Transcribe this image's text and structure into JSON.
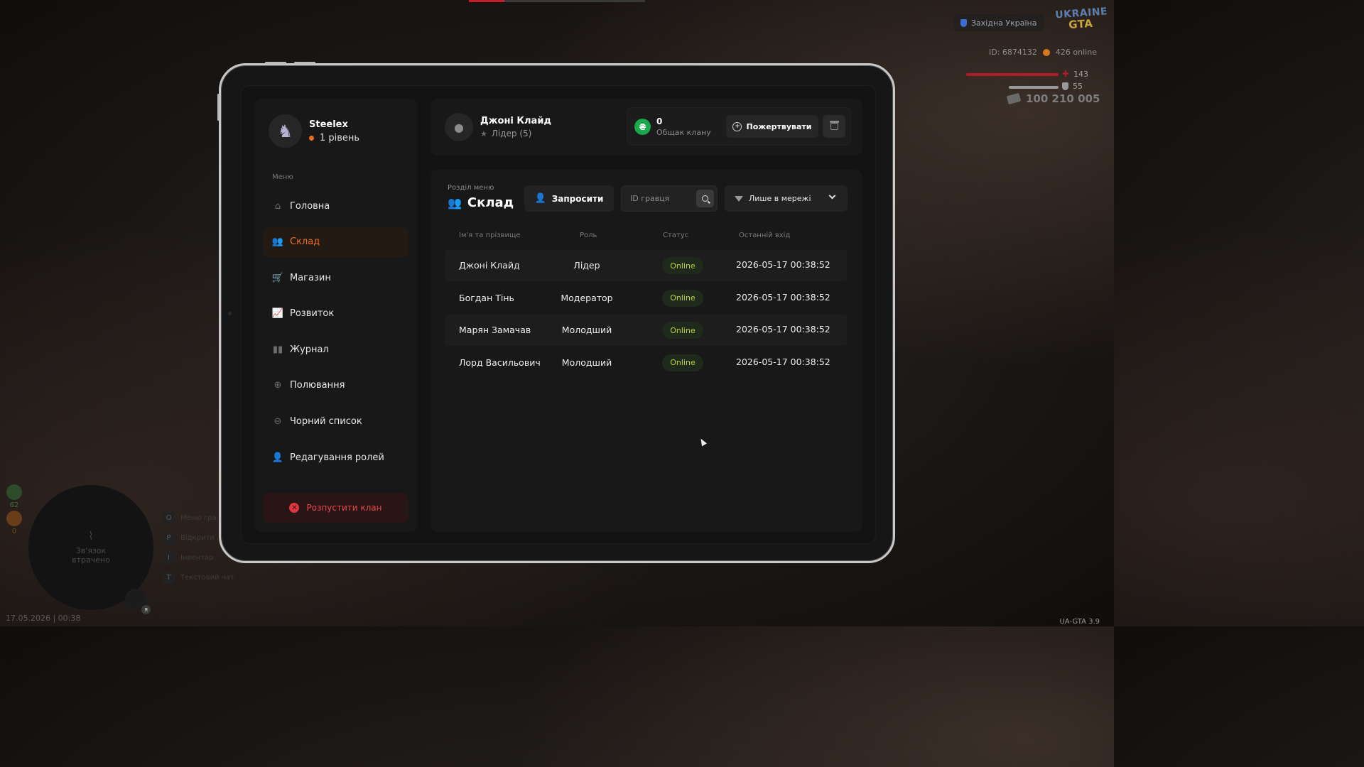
{
  "hud": {
    "server": "Західна Україна",
    "logo_line1": "UKRAINE",
    "logo_line2": "GTA",
    "player_id": "ID: 6874132",
    "online": "426 online",
    "health": "143",
    "armor": "55",
    "money": "100 210 005",
    "minimap_text": "Зв'язок втрачено",
    "mic_key": "Я",
    "side_values": [
      "62",
      "0"
    ],
    "hints": [
      {
        "key": "O",
        "label": "Меню гра..."
      },
      {
        "key": "P",
        "label": "Відкрити ..."
      },
      {
        "key": "I",
        "label": "Інвентар"
      },
      {
        "key": "T",
        "label": "Текстовий чат"
      }
    ],
    "datetime": "17.05.2026 | 00:38",
    "version": "UA-GTA 3.9"
  },
  "sidebar": {
    "username": "Steelex",
    "level": "1 рівень",
    "menu_title": "Меню",
    "items": [
      {
        "label": "Головна",
        "icon": "home-icon"
      },
      {
        "label": "Склад",
        "icon": "members-icon"
      },
      {
        "label": "Магазин",
        "icon": "shop-icon"
      },
      {
        "label": "Розвиток",
        "icon": "chart-icon"
      },
      {
        "label": "Журнал",
        "icon": "book-icon"
      },
      {
        "label": "Полювання",
        "icon": "target-icon"
      },
      {
        "label": "Чорний список",
        "icon": "block-icon"
      },
      {
        "label": "Редагування ролей",
        "icon": "user-edit-icon"
      }
    ],
    "active_index": 1,
    "dissolve_label": "Розпустити клан"
  },
  "header": {
    "leader_name": "Джоні Клайд",
    "leader_role": "Лідер (5)",
    "bank_amount": "0",
    "bank_label": "Общак клану",
    "currency_symbol": "₴",
    "donate_label": "Пожертвувати"
  },
  "main": {
    "section_sub": "Розділ меню",
    "section_title": "Склад",
    "invite_label": "Запросити",
    "search_placeholder": "ID гравця",
    "filter_label": "Лише в мережі",
    "columns": [
      "Ім'я та прізвище",
      "Роль",
      "Статус",
      "Останній вхід"
    ],
    "members": [
      {
        "name": "Джоні Клайд",
        "role": "Лідер",
        "status": "Online",
        "last": "2026-05-17 00:38:52"
      },
      {
        "name": "Богдан Тінь",
        "role": "Модератор",
        "status": "Online",
        "last": "2026-05-17 00:38:52"
      },
      {
        "name": "Марян Замачав",
        "role": "Молодший",
        "status": "Online",
        "last": "2026-05-17 00:38:52"
      },
      {
        "name": "Лорд Васильович",
        "role": "Молодший",
        "status": "Online",
        "last": "2026-05-17 00:38:52"
      }
    ]
  },
  "colors": {
    "accent": "#f26f1f",
    "online": "#b8d638",
    "danger": "#e5484d",
    "coin": "#19a84a"
  }
}
